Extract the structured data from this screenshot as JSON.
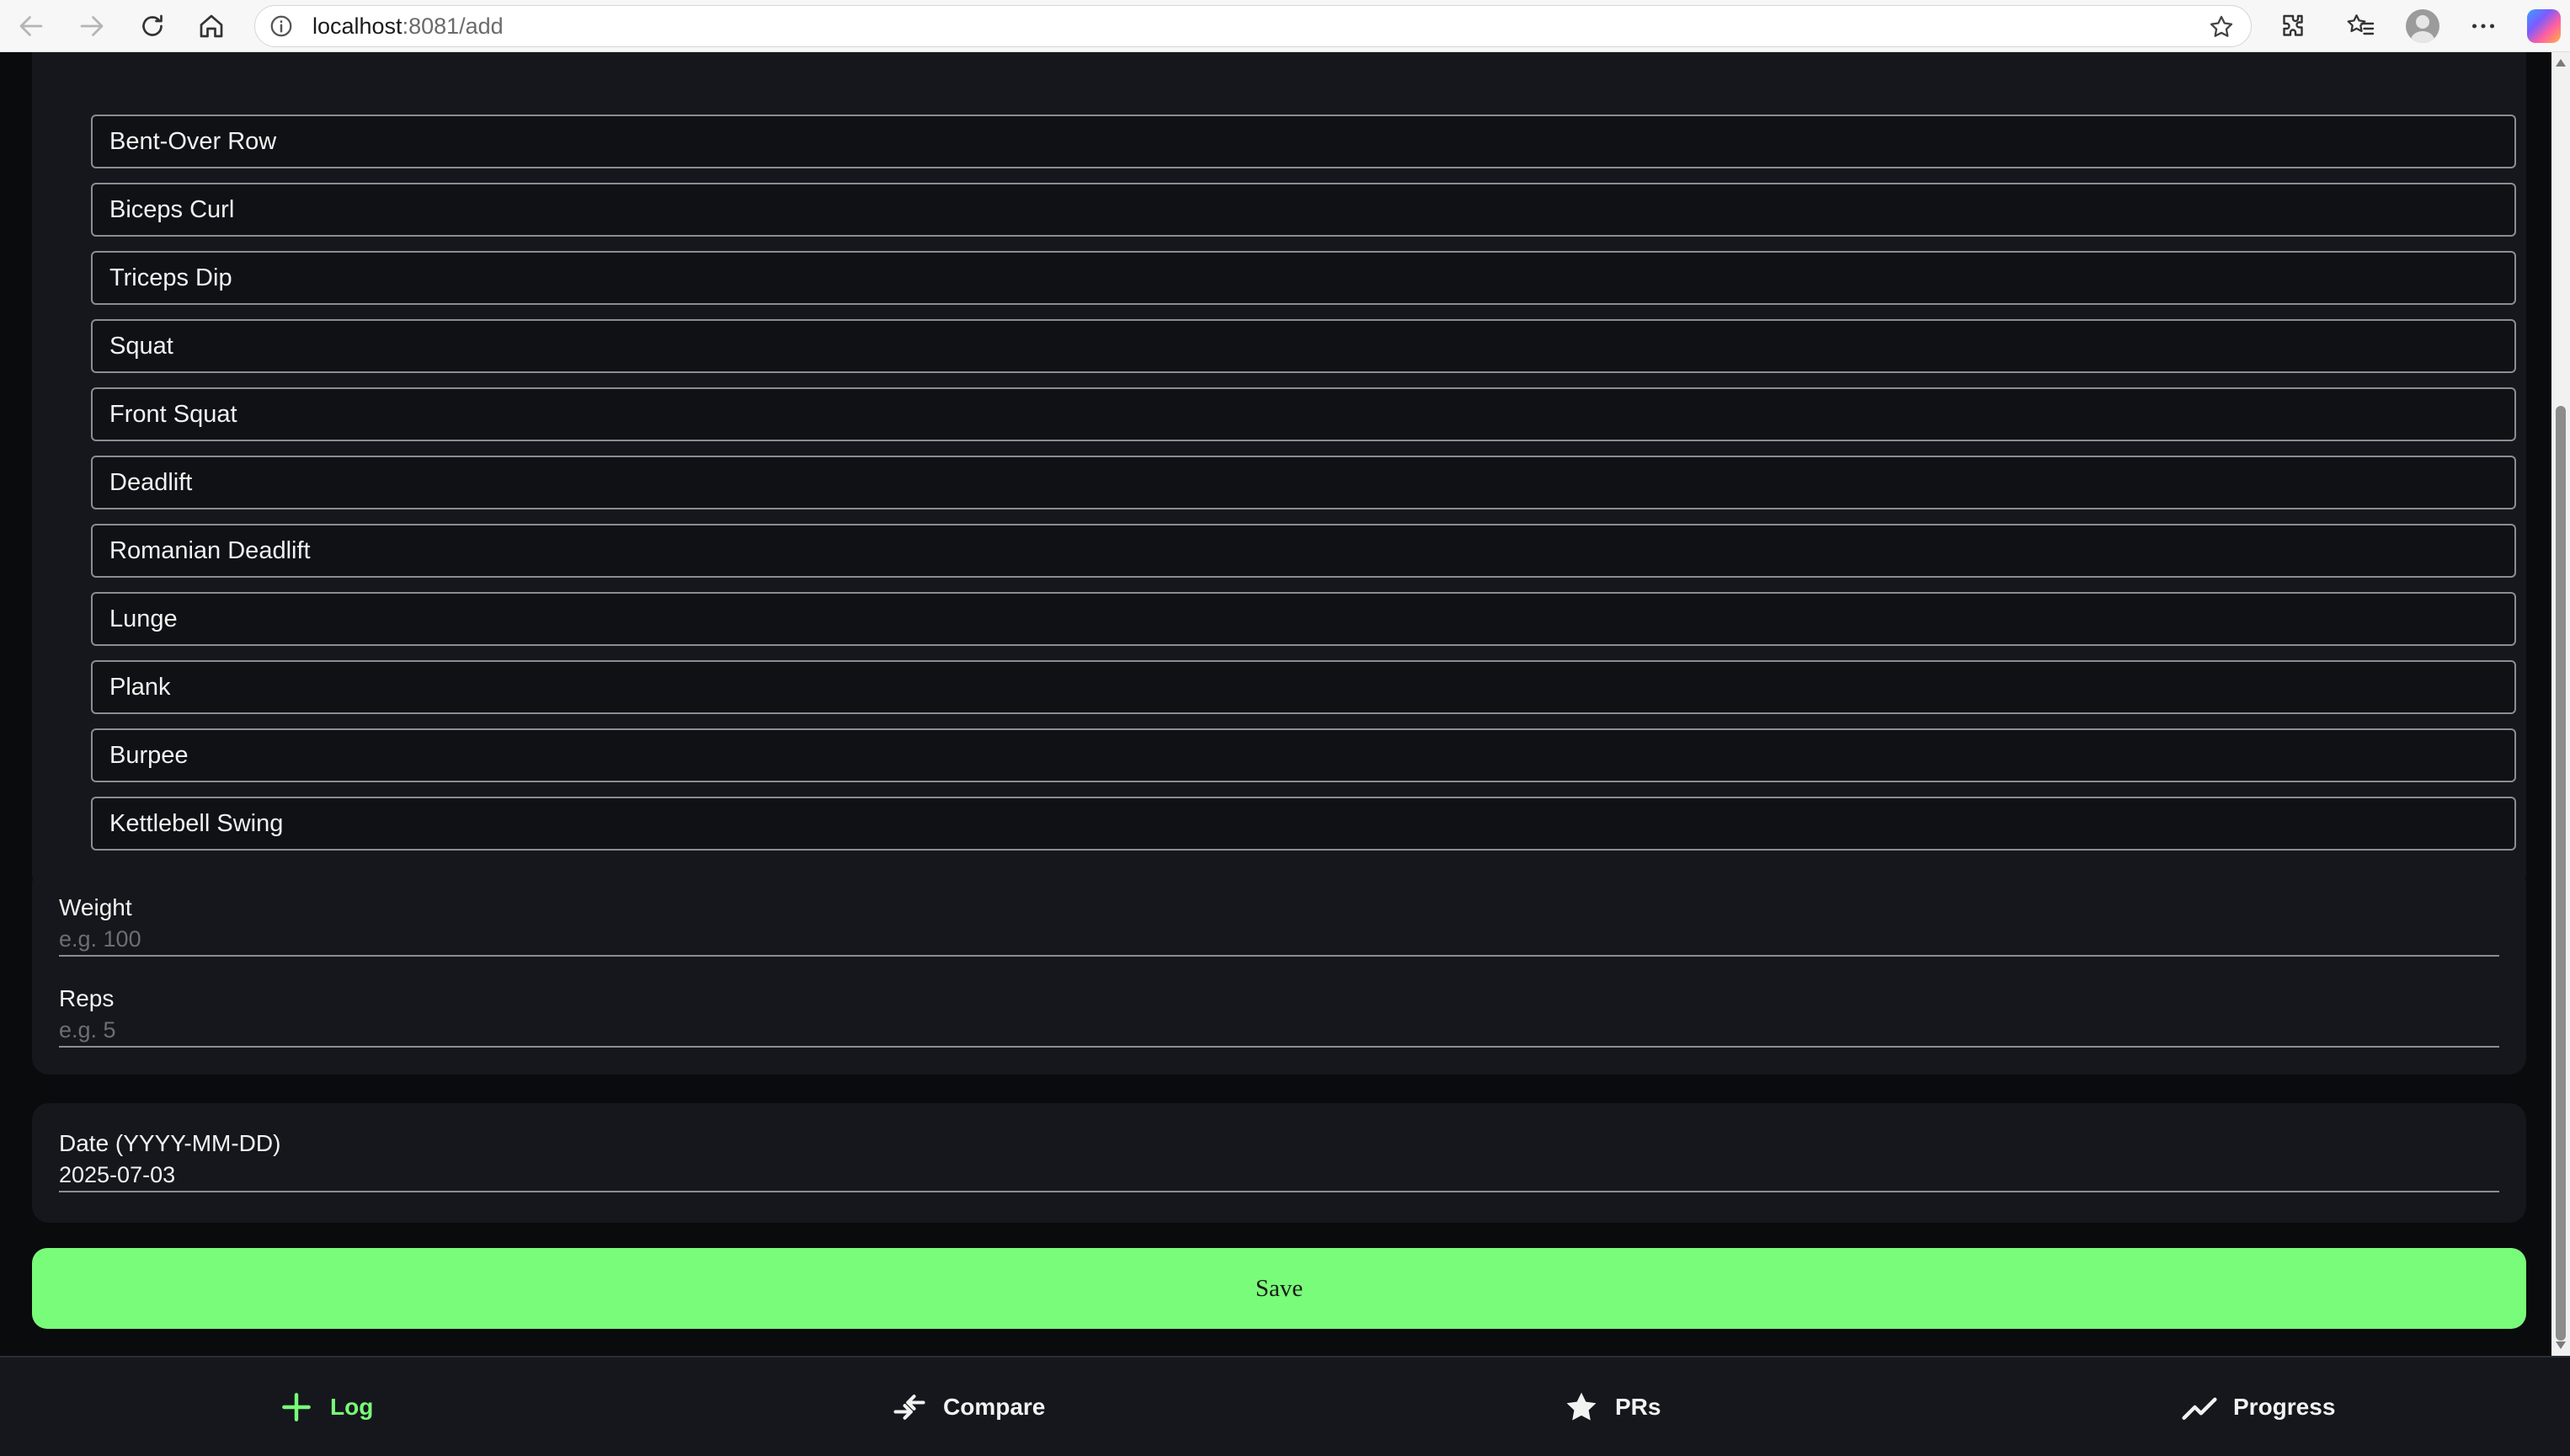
{
  "browser": {
    "url_host": "localhost",
    "url_rest": ":8081/add"
  },
  "exercises": [
    "Bent-Over Row",
    "Biceps Curl",
    "Triceps Dip",
    "Squat",
    "Front Squat",
    "Deadlift",
    "Romanian Deadlift",
    "Lunge",
    "Plank",
    "Burpee",
    "Kettlebell Swing"
  ],
  "form": {
    "weight_label": "Weight",
    "weight_placeholder": "e.g. 100",
    "weight_value": "",
    "reps_label": "Reps",
    "reps_placeholder": "e.g. 5",
    "reps_value": "",
    "date_label": "Date (YYYY-MM-DD)",
    "date_value": "2025-07-03",
    "save_label": "Save"
  },
  "tabs": [
    {
      "label": "Log",
      "icon": "plus-icon",
      "active": true
    },
    {
      "label": "Compare",
      "icon": "compare-arrows-icon",
      "active": false
    },
    {
      "label": "PRs",
      "icon": "star-icon",
      "active": false
    },
    {
      "label": "Progress",
      "icon": "trending-up-icon",
      "active": false
    }
  ],
  "colors": {
    "accent": "#79fc79",
    "background": "#0a0b0d",
    "card": "#15171c"
  }
}
